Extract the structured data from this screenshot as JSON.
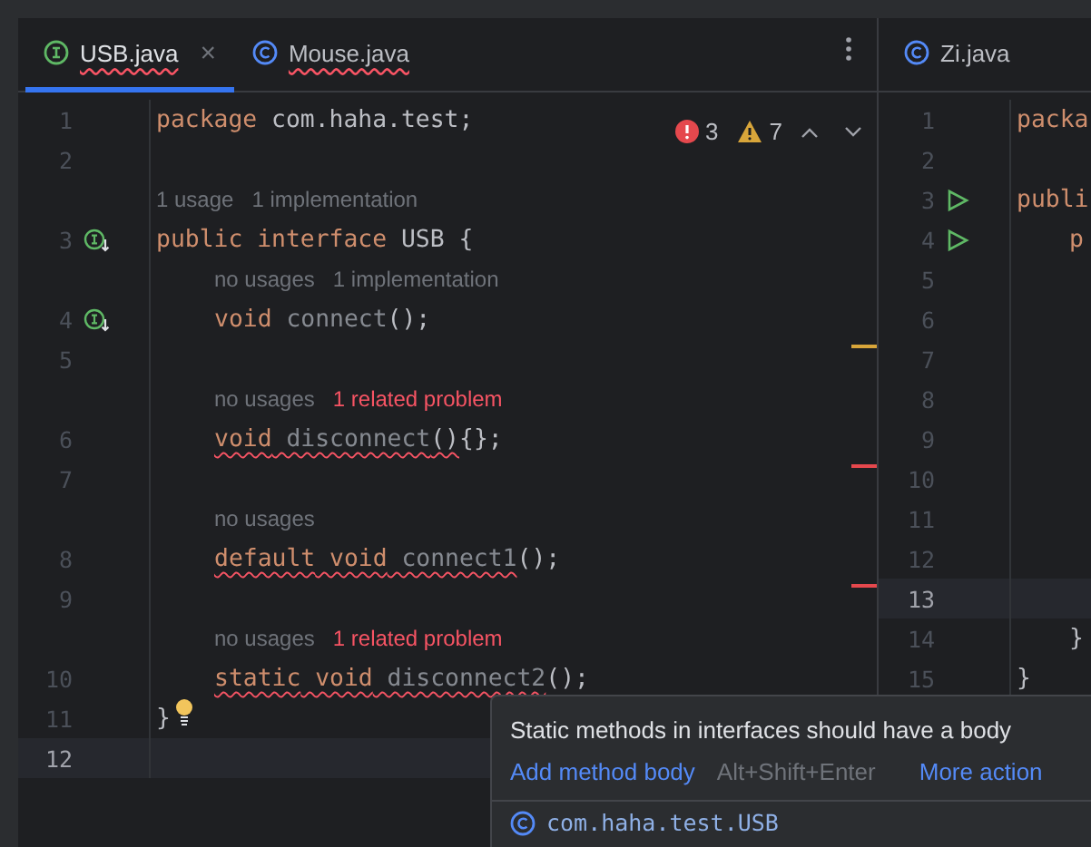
{
  "left_editor": {
    "tabs": [
      {
        "kind": "interface",
        "label": "USB.java",
        "selected": true,
        "has_errors": true,
        "close": "×"
      },
      {
        "kind": "class",
        "label": "Mouse.java",
        "selected": false,
        "has_errors": true
      }
    ],
    "inspection": {
      "errors": "3",
      "warnings": "7"
    },
    "lines": [
      {
        "kind": "code",
        "number": "1",
        "tokens": [
          {
            "kind": "keyword",
            "text": "package"
          },
          {
            "kind": "plain",
            "text": " com.haha.test;"
          }
        ]
      },
      {
        "kind": "code",
        "number": "2"
      },
      {
        "kind": "hint",
        "parts": [
          {
            "kind": "usage",
            "text": "1 usage"
          },
          {
            "kind": "usage",
            "text": "1 implementation"
          }
        ]
      },
      {
        "kind": "code",
        "number": "3",
        "gutter_icon": {
          "kind": "implemented"
        },
        "tokens": [
          {
            "kind": "keyword",
            "text": "public"
          },
          {
            "kind": "keyword",
            "text": " interface"
          },
          {
            "kind": "plain",
            "text": " USB {"
          }
        ],
        "children": [
          {
            "kind": "hint",
            "parts": [
              {
                "kind": "usage",
                "text": "no usages"
              },
              {
                "kind": "usage",
                "text": "1 implementation"
              }
            ]
          },
          {
            "kind": "code",
            "number": "4",
            "gutter_icon": {
              "kind": "implemented"
            },
            "tokens": [
              {
                "kind": "keyword",
                "text": "void"
              },
              {
                "kind": "unused",
                "text": " connect"
              },
              {
                "kind": "plain",
                "text": "();"
              }
            ]
          },
          {
            "kind": "code",
            "number": "5",
            "stripe": {
              "kind": "warning"
            }
          },
          {
            "kind": "hint",
            "parts": [
              {
                "kind": "usage",
                "text": "no usages"
              },
              {
                "kind": "problem",
                "text": "1 related problem"
              }
            ]
          },
          {
            "kind": "code",
            "number": "6",
            "tokens": [
              {
                "kind": "keyword",
                "text": "void",
                "error": true
              },
              {
                "kind": "unused",
                "text": " disconnect",
                "error": true
              },
              {
                "kind": "plain",
                "text": "()",
                "error": true
              },
              {
                "kind": "plain",
                "text": "{};",
                "error": false
              }
            ]
          },
          {
            "kind": "code",
            "number": "7",
            "stripe": {
              "kind": "error"
            }
          },
          {
            "kind": "hint",
            "parts": [
              {
                "kind": "usage",
                "text": "no usages"
              }
            ]
          },
          {
            "kind": "code",
            "number": "8",
            "tokens": [
              {
                "kind": "keyword",
                "text": "default",
                "error": true
              },
              {
                "kind": "keyword",
                "text": " void",
                "error": true
              },
              {
                "kind": "unused",
                "text": " connect1",
                "error": true
              },
              {
                "kind": "plain",
                "text": "();",
                "error": false
              }
            ]
          },
          {
            "kind": "code",
            "number": "9",
            "stripe": {
              "kind": "error"
            }
          },
          {
            "kind": "hint",
            "parts": [
              {
                "kind": "usage",
                "text": "no usages"
              },
              {
                "kind": "problem",
                "text": "1 related problem"
              }
            ]
          },
          {
            "kind": "code",
            "number": "10",
            "tokens": [
              {
                "kind": "keyword",
                "text": "static",
                "error": true
              },
              {
                "kind": "keyword",
                "text": " void",
                "error": true
              },
              {
                "kind": "unused",
                "text": " disconnect2",
                "error": true
              },
              {
                "kind": "plain",
                "text": "();",
                "error": false
              }
            ]
          }
        ]
      },
      {
        "kind": "code",
        "number": "11",
        "bulb": true,
        "tokens": [
          {
            "kind": "plain",
            "text": "}"
          }
        ]
      },
      {
        "kind": "code",
        "number": "12",
        "current": true
      }
    ]
  },
  "right_editor": {
    "tabs": [
      {
        "kind": "class",
        "label": "Zi.java",
        "selected": false,
        "has_errors": false
      }
    ],
    "lines": [
      {
        "number": "1",
        "text": "packa"
      },
      {
        "number": "2"
      },
      {
        "number": "3",
        "gutter_icon": {
          "kind": "run"
        },
        "text": "publi",
        "children": [
          {
            "number": "4",
            "gutter_icon": {
              "kind": "run"
            },
            "text": "p"
          },
          {
            "number": "5"
          },
          {
            "number": "6"
          },
          {
            "number": "7"
          },
          {
            "number": "8"
          },
          {
            "number": "9"
          },
          {
            "number": "10"
          },
          {
            "number": "11"
          },
          {
            "number": "12"
          },
          {
            "number": "13",
            "current": true
          },
          {
            "number": "14",
            "text": "}"
          }
        ]
      },
      {
        "number": "15",
        "text": "}"
      }
    ]
  },
  "popup": {
    "message": "Static methods in interfaces should have a body",
    "actions": [
      {
        "kind": "link",
        "text": "Add method body"
      },
      {
        "kind": "shortcut",
        "text": "Alt+Shift+Enter"
      },
      {
        "kind": "link",
        "text": "More action"
      }
    ],
    "footer": {
      "kind": "class",
      "text": "com.haha.test.USB"
    }
  }
}
